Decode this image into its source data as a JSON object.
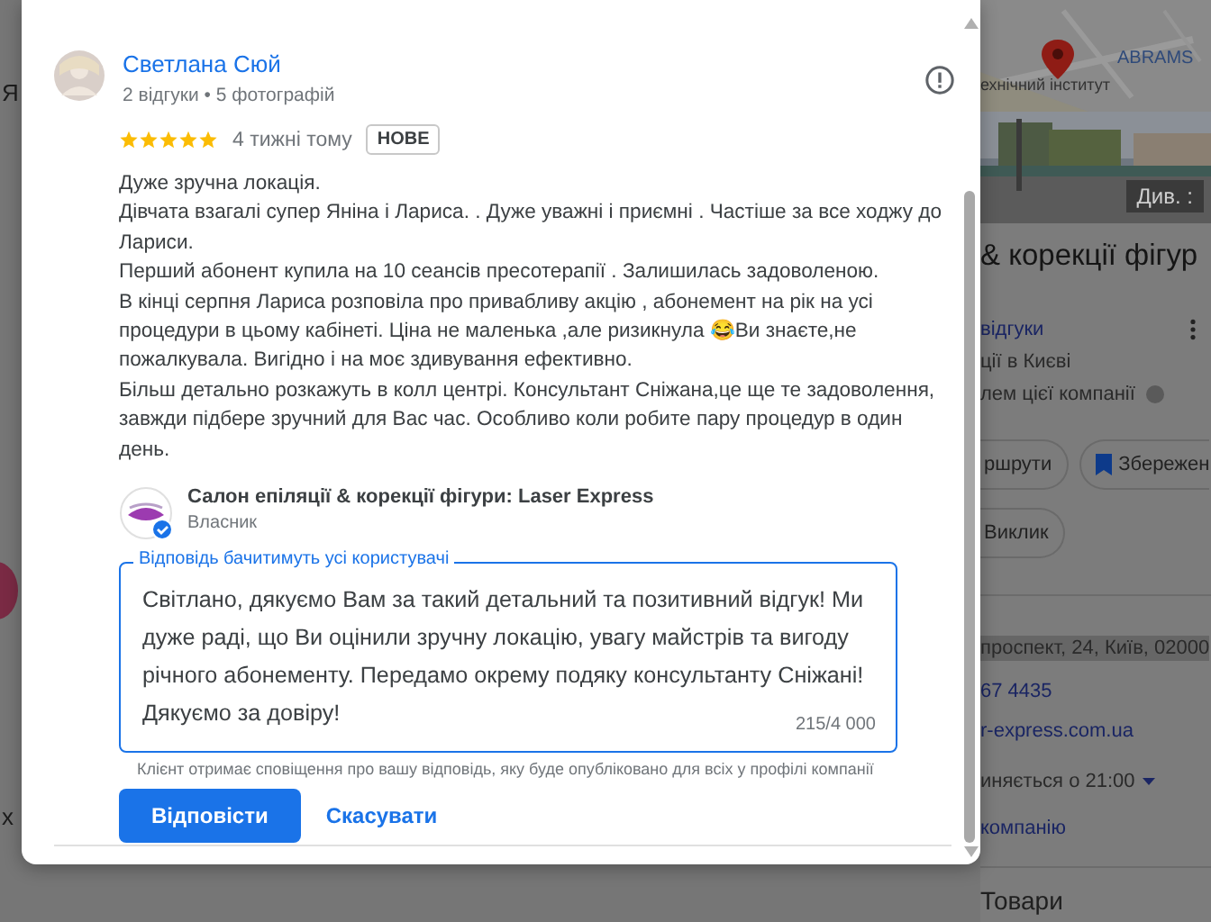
{
  "left_panel": {
    "texts": [
      "Я",
      "х"
    ]
  },
  "review": {
    "author": "Светлана Сюй",
    "meta": "2 відгуки • 5 фотографій",
    "stars": 5,
    "time": "4 тижні тому",
    "badge": "НОВЕ",
    "text": "Дуже зручна локація.\nДівчата взагалі супер Яніна і Лариса. . Дуже уважні і приємні . Частіше за все ходжу до Лариси.\nПерший абонент купила на 10 сеансів пресотерапії . Залишилась задоволеною.\nВ кінці серпня Лариса розповіла про привабливу акцію , абонемент на рік на усі процедури в цьому кабінеті. Ціна не маленька ,але ризикнула 😂Ви знаєте,не пожалкувала. Вигідно і на моє здивування ефективно.\nБільш детально розкажуть в колл центрі. Консультант Сніжана,це ще те задоволення, завжди підбере зручний для Вас час. Особливо коли робите пару процедур в один день."
  },
  "reply": {
    "business": "Салон епіляції & корекції фігури: Laser Express",
    "role": "Власник",
    "verified": true,
    "label": "Відповідь бачитимуть усі користувачі",
    "value": "Світлано, дякуємо Вам за такий детальний та позитивний відгук! Ми дуже раді, що Ви оцінили зручну локацію, увагу майстрів та вигоду річного абонементу. Передамо окрему подяку консультанту Сніжані! Дякуємо за довіру!",
    "counter": "215/4 000",
    "hint": "Клієнт отримає сповіщення про вашу відповідь, яку буде опубліковано для всіх у профілі компанії",
    "buttons": [
      {
        "label": "Відповісти",
        "kind": "primary"
      },
      {
        "label": "Скасувати",
        "kind": "text"
      }
    ]
  },
  "place_panel": {
    "map": {
      "place_label": "ехнічний інститут",
      "brand_label": "ABRAMS"
    },
    "photo": {
      "caption": "Див. :"
    },
    "title": "& корекції фігур",
    "reviews_link": "відгуки",
    "category": "ції в Києві",
    "owner_note": "лем цієї компанії",
    "actions": [
      {
        "label": "ршрути",
        "kind": "plain"
      },
      {
        "label": "Збережен",
        "kind": "save"
      },
      {
        "label": "Виклик",
        "kind": "plain"
      }
    ],
    "address": "проспект, 24, Київ, 02000",
    "phone": "67 4435",
    "website": "r-express.com.ua",
    "hours": "иняється о 21:00",
    "claim_link": "компанію",
    "section": "Товари"
  }
}
